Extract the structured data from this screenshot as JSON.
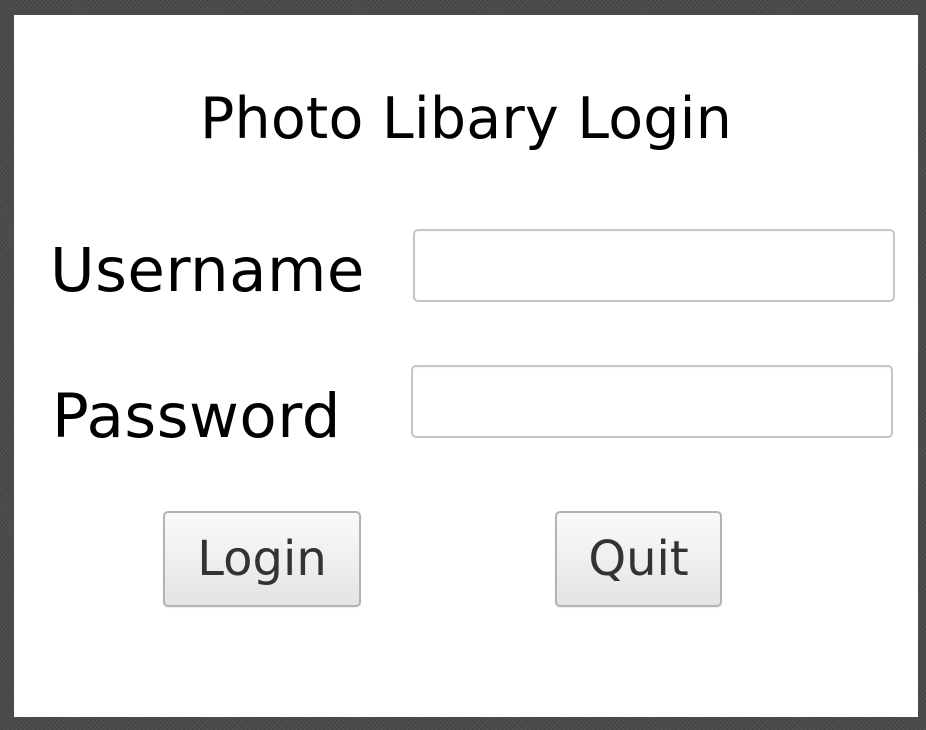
{
  "window": {
    "title": "Photo Libary Login"
  },
  "form": {
    "username": {
      "label": "Username",
      "value": "",
      "placeholder": ""
    },
    "password": {
      "label": "Password",
      "value": "",
      "placeholder": ""
    }
  },
  "actions": {
    "login_label": "Login",
    "quit_label": "Quit"
  },
  "colors": {
    "background": "#ffffff",
    "text": "#000000",
    "button_text": "#333333",
    "input_border": "#c6c6c6",
    "button_border": "#b3b3b3",
    "desktop": "#4a4a4a"
  }
}
